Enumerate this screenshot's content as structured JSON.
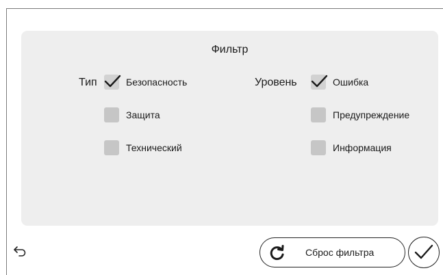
{
  "filter": {
    "title": "Фильтр",
    "type": {
      "label": "Тип",
      "options": [
        {
          "label": "Безопасность",
          "checked": true
        },
        {
          "label": "Защита",
          "checked": false
        },
        {
          "label": "Технический",
          "checked": false
        }
      ]
    },
    "level": {
      "label": "Уровень",
      "options": [
        {
          "label": "Ошибка",
          "checked": true
        },
        {
          "label": "Предупреждение",
          "checked": false
        },
        {
          "label": "Информация",
          "checked": false
        }
      ]
    }
  },
  "footer": {
    "back_icon": "back-arrow-icon",
    "reset_label": "Сброс фильтра",
    "reset_icon": "refresh-icon",
    "confirm_icon": "checkmark-icon"
  },
  "colors": {
    "panel": "#eeeeee",
    "checkbox": "#c6c6c6",
    "text": "#1a1a1a"
  }
}
